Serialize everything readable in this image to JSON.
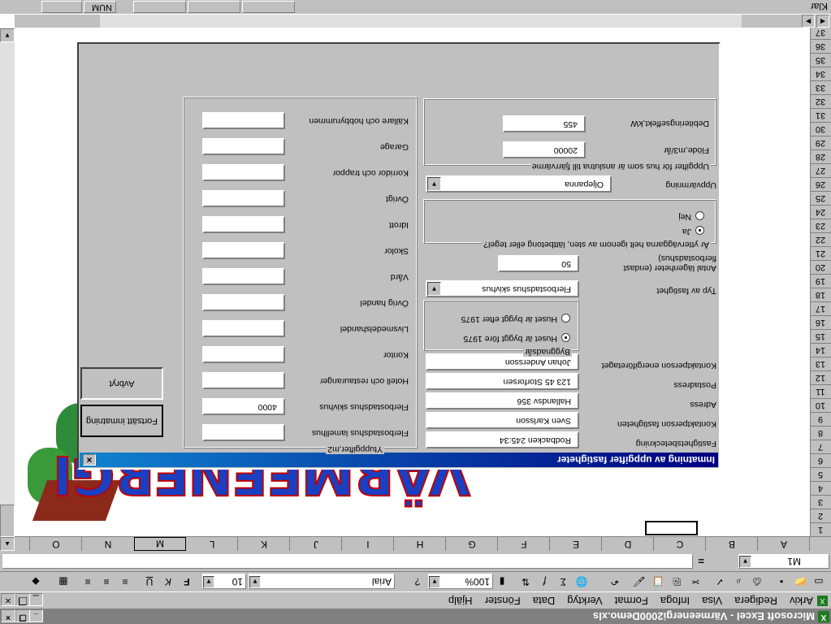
{
  "window": {
    "title": "Microsoft Excel - Värmeenergi2000Demo.xls"
  },
  "menu": [
    "Arkiv",
    "Redigera",
    "Visa",
    "Infoga",
    "Format",
    "Verktyg",
    "Data",
    "Fönster",
    "Hjälp"
  ],
  "toolbar": {
    "zoom": "100%",
    "font": "Arial",
    "size": "10"
  },
  "formula": {
    "namebox": "M1",
    "equals": "="
  },
  "columns": [
    "A",
    "B",
    "C",
    "D",
    "E",
    "F",
    "G",
    "H",
    "I",
    "J",
    "K",
    "L",
    "M",
    "N",
    "O"
  ],
  "rows": [
    "1",
    "2",
    "3",
    "4",
    "5",
    "6",
    "7",
    "8",
    "9",
    "10",
    "11",
    "12",
    "13",
    "14",
    "15",
    "16",
    "17",
    "18",
    "19",
    "20",
    "21",
    "22",
    "23",
    "24",
    "25",
    "26",
    "27",
    "28",
    "29",
    "30",
    "31",
    "32",
    "33",
    "34",
    "35",
    "36",
    "37"
  ],
  "logo": {
    "text": "VÄRMEENERGI"
  },
  "status": {
    "ready": "Klar",
    "num": "NUM"
  },
  "dialog": {
    "title": "Inmatning av uppgifter fastigheter",
    "close": "×",
    "left": {
      "fastighet_label": "Fastighetsbeteckning",
      "fastighet_value": "Rodbacken 245:34",
      "kontakt_label": "Kontaktperson fastigheten",
      "kontakt_value": "Sven Karlsson",
      "adress_label": "Adress",
      "adress_value": "Hallandsv 356",
      "postadress_label": "Postadress",
      "postadress_value": "123 45 Storforsen",
      "energi_label": "Kontaktperson energiföretaget",
      "energi_value": "Johan Andersson",
      "byggnadsar_title": "Byggnadsår",
      "byggnadsar_options": [
        "Huset är byggt före 1975",
        "Huset är byggt efter 1975"
      ],
      "typ_label": "Typ av fastighet",
      "typ_value": "Flerbostadshus skivhus",
      "lgh_label": "Antal lägenheter (endast",
      "lgh_label2": "flerbostadshus)",
      "lgh_value": "50",
      "ytter_title": "Är ytterväggarna helt igenom av sten, lättbetong eller tegel?",
      "ytter_options": [
        "Ja",
        "Nej"
      ],
      "uppv_label": "Uppvärmning",
      "uppv_value": "Oljepanna",
      "fjarr_title": "Uppgifter för hus som är anslutna till fjärrvärme",
      "flode_label": "Flöde,m3/år",
      "flode_value": "20000",
      "debit_label": "Debiteringseffekt,kW",
      "debit_value": "455"
    },
    "right": {
      "title": "Ytuppgifter,m2",
      "items": [
        {
          "label": "Flerbostadshus lamellhus",
          "value": ""
        },
        {
          "label": "Flerbostadshus skivhus",
          "value": "4000"
        },
        {
          "label": "Hotell och restauranger",
          "value": ""
        },
        {
          "label": "Kontor",
          "value": ""
        },
        {
          "label": "Livsmedelshandel",
          "value": ""
        },
        {
          "label": "Övrig handel",
          "value": ""
        },
        {
          "label": "Vård",
          "value": ""
        },
        {
          "label": "Skolor",
          "value": ""
        },
        {
          "label": "Idrott",
          "value": ""
        },
        {
          "label": "Övrigt",
          "value": ""
        },
        {
          "label": "Korridor och trappor",
          "value": ""
        },
        {
          "label": "Garage",
          "value": ""
        },
        {
          "label": "Källare och hobbyrummen",
          "value": ""
        }
      ]
    },
    "buttons": {
      "continue": "Fortsätt inmatning",
      "cancel": "Avbryt"
    }
  }
}
